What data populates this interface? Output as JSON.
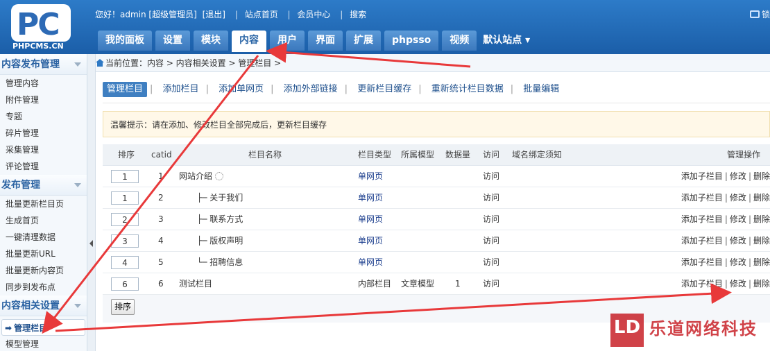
{
  "logo": {
    "mark": "PC",
    "text": "PHPCMS.CN"
  },
  "topbar": {
    "greeting": "您好！admin [超级管理员]",
    "logout": "[退出]",
    "site_home": "站点首页",
    "member_center": "会员中心",
    "search": "搜索",
    "lock": "锁"
  },
  "nav": {
    "tabs": [
      "我的面板",
      "设置",
      "模块",
      "内容",
      "用户",
      "界面",
      "扩展",
      "phpsso",
      "视频"
    ],
    "active_tab": "内容",
    "site_select": "默认站点"
  },
  "sidebar": {
    "groups": [
      {
        "title": "内容发布管理",
        "items": [
          "管理内容",
          "附件管理",
          "专题",
          "碎片管理",
          "采集管理",
          "评论管理"
        ]
      },
      {
        "title": "发布管理",
        "items": [
          "批量更新栏目页",
          "生成首页",
          "一键清理数据",
          "批量更新URL",
          "批量更新内容页",
          "同步到发布点"
        ]
      },
      {
        "title": "内容相关设置",
        "items": [
          "管理栏目",
          "模型管理"
        ]
      }
    ],
    "active_item": "管理栏目"
  },
  "breadcrumb": "当前位置：内容 > 内容相关设置 > 管理栏目 >",
  "subnav": [
    "管理栏目",
    "添加栏目",
    "添加单网页",
    "添加外部链接",
    "更新栏目缓存",
    "重新统计栏目数据",
    "批量编辑"
  ],
  "tip": "温馨提示：请在添加、修改栏目全部完成后，更新栏目缓存",
  "table": {
    "headers": [
      "排序",
      "catid",
      "栏目名称",
      "栏目类型",
      "所属模型",
      "数据量",
      "访问",
      "域名绑定须知",
      "管理操作"
    ],
    "rows": [
      {
        "order": "1",
        "catid": "1",
        "name": "网站介绍",
        "type": "单网页",
        "model": "",
        "count": "",
        "visit": "访问"
      },
      {
        "order": "1",
        "catid": "2",
        "name": "├─ 关于我们",
        "type": "单网页",
        "model": "",
        "count": "",
        "visit": "访问"
      },
      {
        "order": "2",
        "catid": "3",
        "name": "├─ 联系方式",
        "type": "单网页",
        "model": "",
        "count": "",
        "visit": "访问"
      },
      {
        "order": "3",
        "catid": "4",
        "name": "├─ 版权声明",
        "type": "单网页",
        "model": "",
        "count": "",
        "visit": "访问"
      },
      {
        "order": "4",
        "catid": "5",
        "name": "└─ 招聘信息",
        "type": "单网页",
        "model": "",
        "count": "",
        "visit": "访问"
      },
      {
        "order": "6",
        "catid": "6",
        "name": "测试栏目",
        "type": "内部栏目",
        "model": "文章模型",
        "count": "1",
        "visit": "访问"
      }
    ],
    "actions": [
      "添加子栏目",
      "修改",
      "删除"
    ],
    "sort_button": "排序"
  },
  "watermark": {
    "mark": "LD",
    "text": "乐道网络科技"
  },
  "colors": {
    "header": "#1b5ea8",
    "annotation_arrow": "#e8393a",
    "link": "#1d3f8e"
  }
}
